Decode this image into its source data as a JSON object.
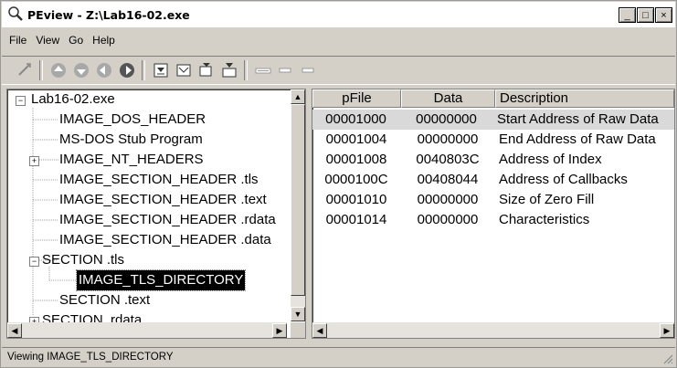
{
  "window": {
    "title": "PEview - Z:\\Lab16-02.exe",
    "minimize": "_",
    "maximize": "□",
    "close": "×"
  },
  "menu": [
    "File",
    "View",
    "Go",
    "Help"
  ],
  "tree": {
    "items": [
      {
        "label": "Lab16-02.exe",
        "expander": "−"
      },
      {
        "label": "IMAGE_DOS_HEADER"
      },
      {
        "label": "MS-DOS Stub Program"
      },
      {
        "label": "IMAGE_NT_HEADERS",
        "expander": "+"
      },
      {
        "label": "IMAGE_SECTION_HEADER .tls"
      },
      {
        "label": "IMAGE_SECTION_HEADER .text"
      },
      {
        "label": "IMAGE_SECTION_HEADER .rdata"
      },
      {
        "label": "IMAGE_SECTION_HEADER .data"
      },
      {
        "label": "SECTION .tls",
        "expander": "−"
      },
      {
        "label": "IMAGE_TLS_DIRECTORY",
        "selected": true
      },
      {
        "label": "SECTION .text"
      },
      {
        "label": "SECTION .rdata",
        "expander": "+"
      }
    ]
  },
  "table": {
    "headers": [
      "pFile",
      "Data",
      "Description"
    ],
    "rows": [
      [
        "00001000",
        "00000000",
        "Start Address of Raw Data"
      ],
      [
        "00001004",
        "00000000",
        "End Address of Raw Data"
      ],
      [
        "00001008",
        "0040803C",
        "Address of Index"
      ],
      [
        "0000100C",
        "00408044",
        "Address of Callbacks"
      ],
      [
        "00001010",
        "00000000",
        "Size of Zero Fill"
      ],
      [
        "00001014",
        "00000000",
        "Characteristics"
      ]
    ]
  },
  "status": "Viewing IMAGE_TLS_DIRECTORY",
  "colors": {
    "selection": "#000000",
    "highlight_row": "#d9d9d9",
    "chrome": "#d4d0c8"
  }
}
